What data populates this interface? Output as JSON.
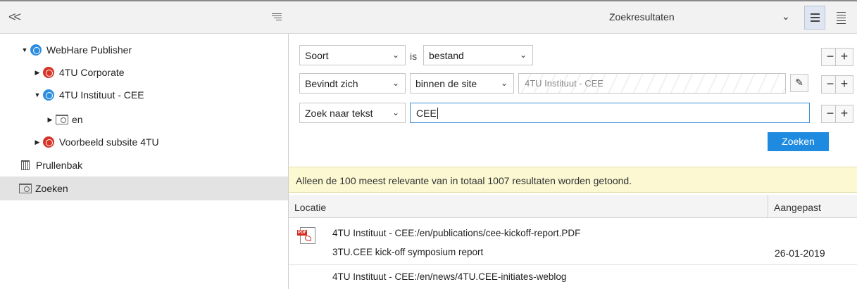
{
  "left": {
    "tree": [
      {
        "label": "WebHare Publisher",
        "toggle": "▼",
        "icon": "blue-globe-icon"
      },
      {
        "label": "4TU Corporate",
        "toggle": "▶",
        "icon": "red-globe-icon"
      },
      {
        "label": "4TU Instituut - CEE",
        "toggle": "▼",
        "icon": "blue-globe-icon"
      },
      {
        "label": "en",
        "toggle": "▶",
        "icon": "search-folder-icon"
      },
      {
        "label": "Voorbeeld subsite 4TU",
        "toggle": "▶",
        "icon": "red-globe-icon"
      },
      {
        "label": "Prullenbak",
        "icon": "trash-icon"
      },
      {
        "label": "Zoeken",
        "icon": "search-folder-icon",
        "selected": true
      }
    ],
    "collapse_icon": "double-chevron-left",
    "menu_icon": "hamburger-menu"
  },
  "header": {
    "title": "Zoekresultaten",
    "dropdown_icon": "chevron-down",
    "view_buttons": [
      "list-view",
      "detail-view"
    ]
  },
  "criteria": {
    "row1": {
      "field": "Soort",
      "operator": "is",
      "value": "bestand"
    },
    "row2": {
      "field": "Bevindt zich",
      "operator": "binnen de site",
      "value": "4TU Instituut - CEE"
    },
    "row3": {
      "field": "Zoek naar tekst",
      "value": "CEE"
    },
    "minus": "−",
    "plus": "+",
    "search_button": "Zoeken"
  },
  "notice": "Alleen de 100 meest relevante van in totaal 1007 resultaten worden getoond.",
  "columns": {
    "location": "Locatie",
    "modified": "Aangepast"
  },
  "results": [
    {
      "path": "4TU Instituut - CEE:/en/publications/cee-kickoff-report.PDF",
      "title": "3TU.CEE kick-off symposium report",
      "date": "26-01-2019",
      "icon": "pdf-file-icon"
    },
    {
      "path": "4TU Instituut - CEE:/en/news/4TU.CEE-initiates-weblog",
      "title": "",
      "date": ""
    }
  ],
  "colors": {
    "accent": "#1f8be0",
    "notice_bg": "#fbf8d2",
    "selected_row": "#e3e3e3"
  }
}
